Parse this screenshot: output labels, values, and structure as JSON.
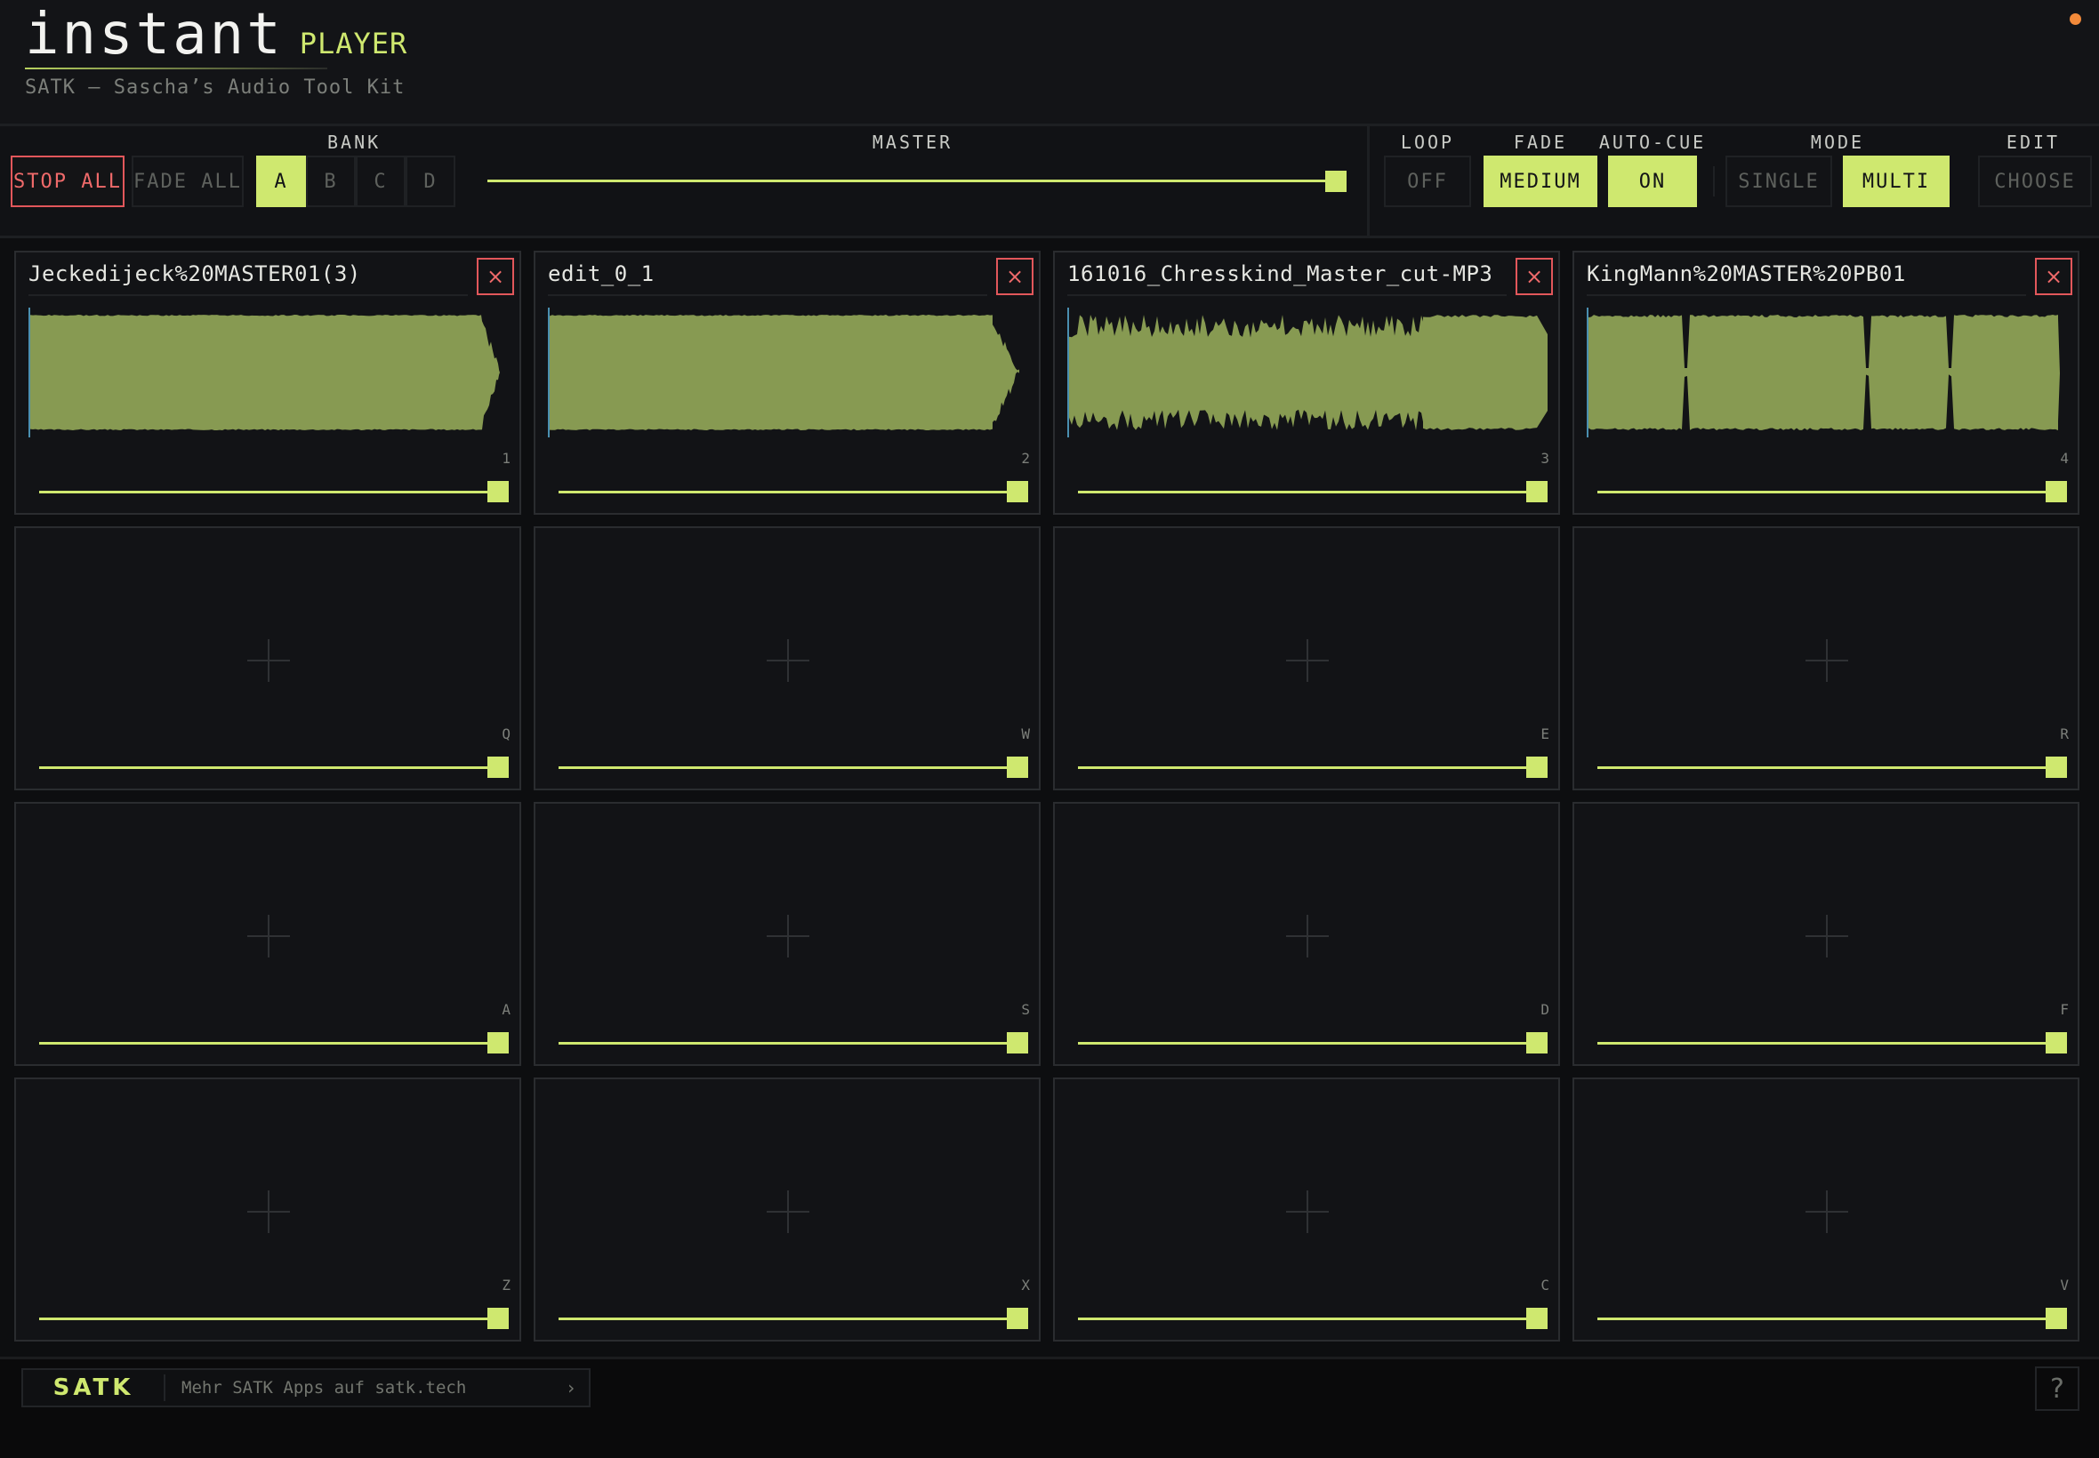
{
  "header": {
    "logo_main": "instant",
    "logo_sub": "PLAYER",
    "tagline": "SATK — Sascha’s Audio Tool Kit"
  },
  "toolbar": {
    "stop_all": "STOP ALL",
    "fade_all": "FADE ALL",
    "bank_label": "BANK",
    "banks": [
      "A",
      "B",
      "C",
      "D"
    ],
    "bank_selected": "A",
    "master_label": "MASTER",
    "master_volume": 1.0,
    "loop_label": "LOOP",
    "loop_value": "OFF",
    "fade_label": "FADE",
    "fade_value": "MEDIUM",
    "autocue_label": "AUTO-CUE",
    "autocue_value": "ON",
    "mode_label": "MODE",
    "mode_single": "SINGLE",
    "mode_multi": "MULTI",
    "mode_selected": "MULTI",
    "edit_label": "EDIT",
    "edit_value": "CHOOSE"
  },
  "pads": [
    {
      "name": "Jeckedijeck%20MASTER01(3)",
      "key": "1",
      "loaded": true,
      "volume": 1.0
    },
    {
      "name": "edit_0_1",
      "key": "2",
      "loaded": true,
      "volume": 1.0
    },
    {
      "name": "161016_Chresskind_Master_cut-MP3",
      "key": "3",
      "loaded": true,
      "volume": 1.0
    },
    {
      "name": "KingMann%20MASTER%20PB01",
      "key": "4",
      "loaded": true,
      "volume": 1.0
    },
    {
      "name": "",
      "key": "Q",
      "loaded": false,
      "volume": 1.0
    },
    {
      "name": "",
      "key": "W",
      "loaded": false,
      "volume": 1.0
    },
    {
      "name": "",
      "key": "E",
      "loaded": false,
      "volume": 1.0
    },
    {
      "name": "",
      "key": "R",
      "loaded": false,
      "volume": 1.0
    },
    {
      "name": "",
      "key": "A",
      "loaded": false,
      "volume": 1.0
    },
    {
      "name": "",
      "key": "S",
      "loaded": false,
      "volume": 1.0
    },
    {
      "name": "",
      "key": "D",
      "loaded": false,
      "volume": 1.0
    },
    {
      "name": "",
      "key": "F",
      "loaded": false,
      "volume": 1.0
    },
    {
      "name": "",
      "key": "Z",
      "loaded": false,
      "volume": 1.0
    },
    {
      "name": "",
      "key": "X",
      "loaded": false,
      "volume": 1.0
    },
    {
      "name": "",
      "key": "C",
      "loaded": false,
      "volume": 1.0
    },
    {
      "name": "",
      "key": "V",
      "loaded": false,
      "volume": 1.0
    }
  ],
  "close_glyph": "×",
  "footer": {
    "logo": "SATK",
    "link_text": "Mehr SATK Apps auf satk.tech",
    "chevron": "›",
    "help": "?"
  },
  "colors": {
    "accent": "#cfe86f",
    "waveform": "#879a52",
    "danger": "#e2575b",
    "status_dot": "#f28a3a",
    "background": "#0d0e10"
  }
}
